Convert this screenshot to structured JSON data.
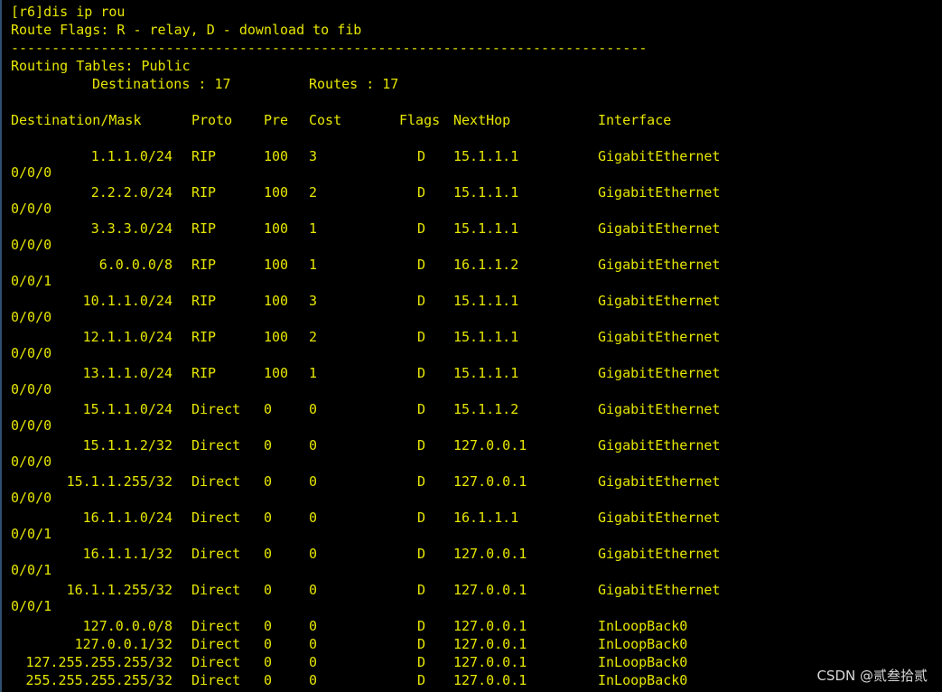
{
  "terminal": {
    "colors": {
      "background": "#000000",
      "text": "#e6e600",
      "watermark": "#d9d9d9"
    },
    "prompt_line": "[r6]dis ip rou",
    "flags_legend": "Route Flags: R - relay, D - download to fib",
    "separator": "------------------------------------------------------------------------------",
    "table_title": "Routing Tables: Public",
    "summary": {
      "destinations_label": "Destinations : 17",
      "routes_label": "Routes : 17"
    },
    "headers": {
      "destination": "Destination/Mask",
      "proto": "Proto",
      "pre": "Pre",
      "cost": "Cost",
      "flags": "Flags",
      "nexthop": "NextHop",
      "interface": "Interface"
    },
    "routes": [
      {
        "dest": "1.1.1.0/24",
        "proto": "RIP",
        "pre": "100",
        "cost": "3",
        "flags": "D",
        "nexthop": "15.1.1.1",
        "iface": "GigabitEthernet",
        "iface_cont": "0/0/0"
      },
      {
        "dest": "2.2.2.0/24",
        "proto": "RIP",
        "pre": "100",
        "cost": "2",
        "flags": "D",
        "nexthop": "15.1.1.1",
        "iface": "GigabitEthernet",
        "iface_cont": "0/0/0"
      },
      {
        "dest": "3.3.3.0/24",
        "proto": "RIP",
        "pre": "100",
        "cost": "1",
        "flags": "D",
        "nexthop": "15.1.1.1",
        "iface": "GigabitEthernet",
        "iface_cont": "0/0/0"
      },
      {
        "dest": "6.0.0.0/8",
        "proto": "RIP",
        "pre": "100",
        "cost": "1",
        "flags": "D",
        "nexthop": "16.1.1.2",
        "iface": "GigabitEthernet",
        "iface_cont": "0/0/1"
      },
      {
        "dest": "10.1.1.0/24",
        "proto": "RIP",
        "pre": "100",
        "cost": "3",
        "flags": "D",
        "nexthop": "15.1.1.1",
        "iface": "GigabitEthernet",
        "iface_cont": "0/0/0"
      },
      {
        "dest": "12.1.1.0/24",
        "proto": "RIP",
        "pre": "100",
        "cost": "2",
        "flags": "D",
        "nexthop": "15.1.1.1",
        "iface": "GigabitEthernet",
        "iface_cont": "0/0/0"
      },
      {
        "dest": "13.1.1.0/24",
        "proto": "RIP",
        "pre": "100",
        "cost": "1",
        "flags": "D",
        "nexthop": "15.1.1.1",
        "iface": "GigabitEthernet",
        "iface_cont": "0/0/0"
      },
      {
        "dest": "15.1.1.0/24",
        "proto": "Direct",
        "pre": "0",
        "cost": "0",
        "flags": "D",
        "nexthop": "15.1.1.2",
        "iface": "GigabitEthernet",
        "iface_cont": "0/0/0"
      },
      {
        "dest": "15.1.1.2/32",
        "proto": "Direct",
        "pre": "0",
        "cost": "0",
        "flags": "D",
        "nexthop": "127.0.0.1",
        "iface": "GigabitEthernet",
        "iface_cont": "0/0/0"
      },
      {
        "dest": "15.1.1.255/32",
        "proto": "Direct",
        "pre": "0",
        "cost": "0",
        "flags": "D",
        "nexthop": "127.0.0.1",
        "iface": "GigabitEthernet",
        "iface_cont": "0/0/0"
      },
      {
        "dest": "16.1.1.0/24",
        "proto": "Direct",
        "pre": "0",
        "cost": "0",
        "flags": "D",
        "nexthop": "16.1.1.1",
        "iface": "GigabitEthernet",
        "iface_cont": "0/0/1"
      },
      {
        "dest": "16.1.1.1/32",
        "proto": "Direct",
        "pre": "0",
        "cost": "0",
        "flags": "D",
        "nexthop": "127.0.0.1",
        "iface": "GigabitEthernet",
        "iface_cont": "0/0/1"
      },
      {
        "dest": "16.1.1.255/32",
        "proto": "Direct",
        "pre": "0",
        "cost": "0",
        "flags": "D",
        "nexthop": "127.0.0.1",
        "iface": "GigabitEthernet",
        "iface_cont": "0/0/1"
      },
      {
        "dest": "127.0.0.0/8",
        "proto": "Direct",
        "pre": "0",
        "cost": "0",
        "flags": "D",
        "nexthop": "127.0.0.1",
        "iface": "InLoopBack0",
        "iface_cont": ""
      },
      {
        "dest": "127.0.0.1/32",
        "proto": "Direct",
        "pre": "0",
        "cost": "0",
        "flags": "D",
        "nexthop": "127.0.0.1",
        "iface": "InLoopBack0",
        "iface_cont": ""
      },
      {
        "dest": "127.255.255.255/32",
        "proto": "Direct",
        "pre": "0",
        "cost": "0",
        "flags": "D",
        "nexthop": "127.0.0.1",
        "iface": "InLoopBack0",
        "iface_cont": ""
      },
      {
        "dest": "255.255.255.255/32",
        "proto": "Direct",
        "pre": "0",
        "cost": "0",
        "flags": "D",
        "nexthop": "127.0.0.1",
        "iface": "InLoopBack0",
        "iface_cont": ""
      }
    ]
  },
  "watermark": "CSDN @贰叁拾贰"
}
